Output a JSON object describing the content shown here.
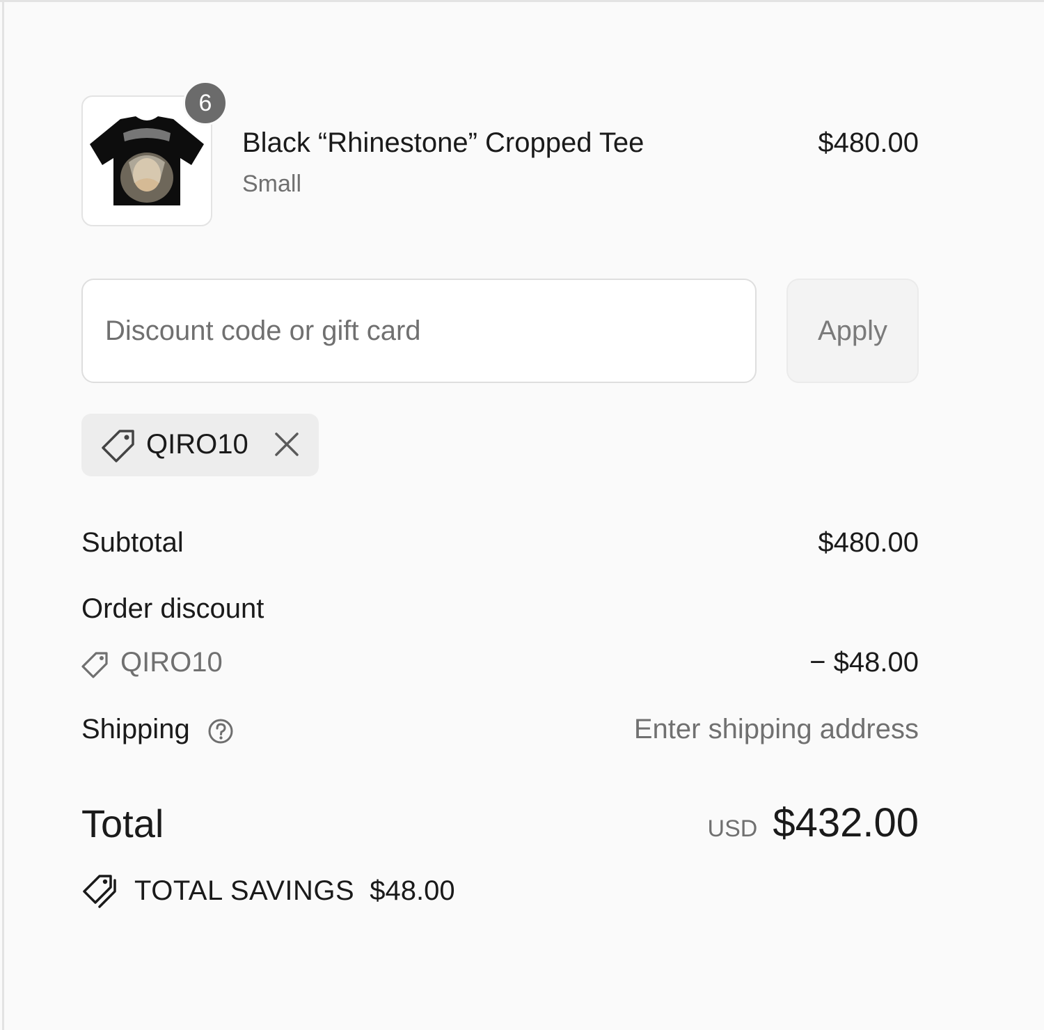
{
  "line_item": {
    "quantity": "6",
    "name": "Black “Rhinestone” Cropped Tee",
    "variant": "Small",
    "price": "$480.00",
    "image_icon": "tshirt-image"
  },
  "discount": {
    "placeholder": "Discount code or gift card",
    "value": "",
    "apply_label": "Apply",
    "applied_code": "QIRO10"
  },
  "summary": {
    "subtotal_label": "Subtotal",
    "subtotal_value": "$480.00",
    "order_discount_label": "Order discount",
    "order_discount_code": "QIRO10",
    "order_discount_value": "− $48.00",
    "shipping_label": "Shipping",
    "shipping_value": "Enter shipping address",
    "total_label": "Total",
    "total_currency": "USD",
    "total_value": "$432.00",
    "savings_label": "TOTAL SAVINGS",
    "savings_value": "$48.00"
  },
  "colors": {
    "background": "#fafafa",
    "text": "#1a1a1a",
    "muted_text": "#707070",
    "badge": "#6b6b6b",
    "chip_background": "#ededed"
  }
}
